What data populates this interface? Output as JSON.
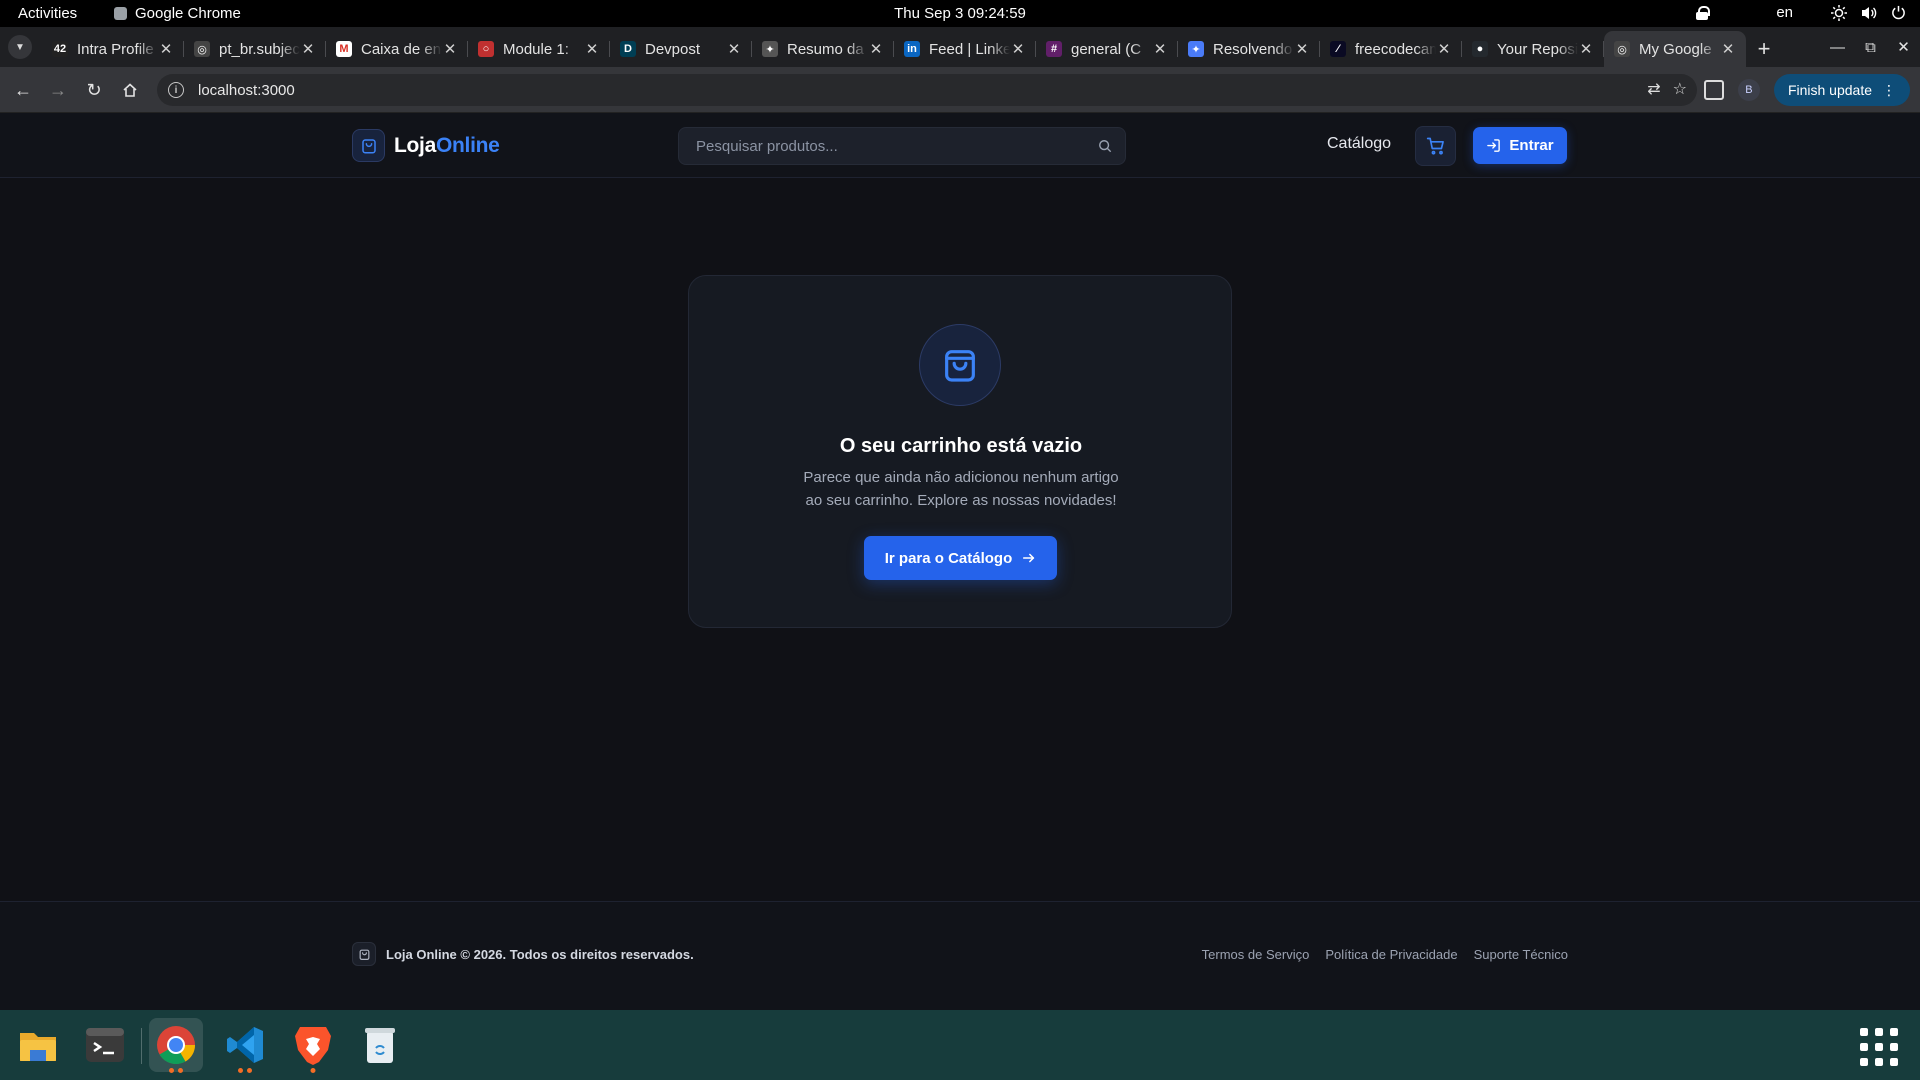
{
  "system_bar": {
    "activities": "Activities",
    "app_name": "Google Chrome",
    "clock": "Thu Sep 3  09:24:59",
    "language": "en"
  },
  "browser": {
    "tabs": [
      {
        "title": "Intra Profile",
        "favicon": "42-icon"
      },
      {
        "title": "pt_br.subject",
        "favicon": "globe-icon"
      },
      {
        "title": "Caixa de entrada",
        "favicon": "gmail-icon"
      },
      {
        "title": "Module 1: ",
        "favicon": "module-icon"
      },
      {
        "title": "Devpost",
        "favicon": "devpost-icon"
      },
      {
        "title": "Resumo da",
        "favicon": "openai-icon"
      },
      {
        "title": "Feed | LinkedIn",
        "favicon": "linkedin-icon"
      },
      {
        "title": "general (C",
        "favicon": "slack-icon"
      },
      {
        "title": "Resolvendo",
        "favicon": "gemini-icon"
      },
      {
        "title": "freecodecamp",
        "favicon": "freecodecamp-icon"
      },
      {
        "title": "Your Repositories",
        "favicon": "github-icon"
      },
      {
        "title": "My Google",
        "favicon": "globe-icon",
        "active": true
      }
    ],
    "url": "localhost:3000",
    "profile_initial": "B",
    "finish_update": "Finish update"
  },
  "site": {
    "logo_part1": "Loja",
    "logo_part2": "Online",
    "search_placeholder": "Pesquisar produtos...",
    "nav_catalog": "Catálogo",
    "login_label": "Entrar",
    "colors": {
      "accent": "#2563eb",
      "background": "#101116",
      "card": "#161a22"
    }
  },
  "empty_cart": {
    "title": "O seu carrinho está vazio",
    "description_line1": "Parece que ainda não adicionou nenhum artigo",
    "description_line2": "ao seu carrinho. Explore as nossas novidades!",
    "cta_label": "Ir para o Catálogo"
  },
  "footer": {
    "copyright": "Loja Online © 2026. Todos os direitos reservados.",
    "links": [
      "Termos de Serviço",
      "Política de Privacidade",
      "Suporte Técnico"
    ]
  },
  "dock": {
    "apps": [
      "files-icon",
      "terminal-icon",
      "chrome-icon",
      "vscode-icon",
      "brave-icon",
      "trash-icon",
      "show-apps-icon"
    ]
  }
}
